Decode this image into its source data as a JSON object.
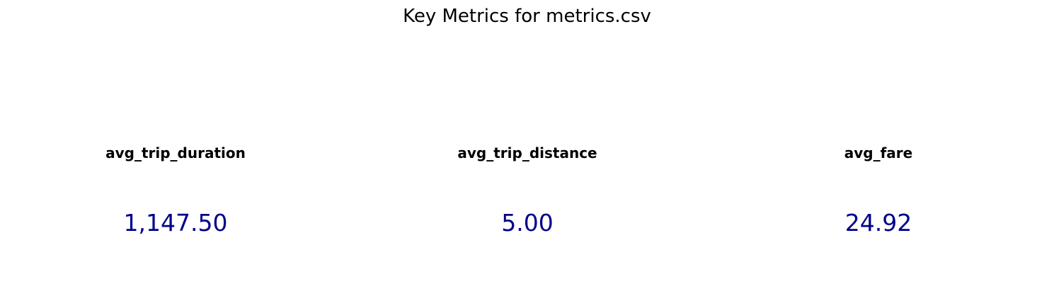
{
  "figure": {
    "title": "Key Metrics for metrics.csv"
  },
  "colors": {
    "value_text": "#00008b",
    "label_text": "#000000",
    "background": "#ffffff"
  },
  "metrics": [
    {
      "label": "avg_trip_duration",
      "value_text": "1,147.50",
      "value": 1147.5
    },
    {
      "label": "avg_trip_distance",
      "value_text": "5.00",
      "value": 5.0
    },
    {
      "label": "avg_fare",
      "value_text": "24.92",
      "value": 24.92
    }
  ],
  "chart_data": {
    "type": "table",
    "title": "Key Metrics for metrics.csv",
    "columns": [
      "avg_trip_duration",
      "avg_trip_distance",
      "avg_fare"
    ],
    "values": [
      1147.5,
      5.0,
      24.92
    ],
    "grid": false
  }
}
